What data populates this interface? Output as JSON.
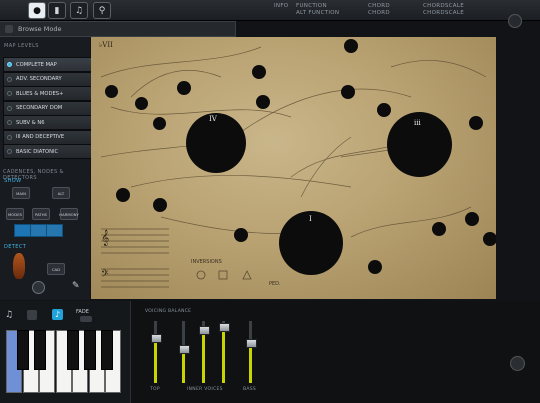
{
  "topbar": {
    "col1": [
      "",
      "INFO"
    ],
    "col2": [
      "FUNCTION",
      "ALT FUNCTION"
    ],
    "col3": [
      "CHORD",
      "CHORD"
    ],
    "col4": [
      "CHORDSCALE",
      "CHORDSCALE"
    ]
  },
  "modebar": {
    "title": "Browse Mode"
  },
  "left": {
    "map_levels_label": "MAP LEVELS",
    "map_levels": [
      {
        "label": "COMPLETE MAP",
        "selected": true
      },
      {
        "label": "ADV. SECONDARY",
        "selected": false
      },
      {
        "label": "BLUES & MODES+",
        "selected": false
      },
      {
        "label": "SECONDARY DOM",
        "selected": false
      },
      {
        "label": "SUBV & N6",
        "selected": false
      },
      {
        "label": "III AND DECEPTIVE",
        "selected": false
      },
      {
        "label": "BASIC DIATONIC",
        "selected": false
      }
    ],
    "cadences_label": "CADENCES, NODES & DETECTORS",
    "show_label": "SHOW",
    "main_label": "MAIN",
    "alt_label": "ALT",
    "modes_label": "MODES",
    "paths_label": "PATHS",
    "harmony_label": "HARMONY",
    "detect_label": "DETECT",
    "cad_label": "CAD"
  },
  "map": {
    "nodes": [
      {
        "id": "IV",
        "text": "IV"
      },
      {
        "id": "iii",
        "text": "iii"
      },
      {
        "id": "I",
        "text": "I"
      },
      {
        "id": "bVII",
        "text": "♭VII"
      }
    ],
    "inversions_label": "INVERSIONS",
    "ped_label": "PED."
  },
  "bottom": {
    "fade_label": "FADE",
    "voicing_label": "VOICING BALANCE",
    "top_label": "TOP",
    "inner_label": "INNER VOICES",
    "bass_label": "BASS",
    "faders": [
      0.72,
      0.55,
      0.85,
      0.9,
      0.65
    ]
  }
}
